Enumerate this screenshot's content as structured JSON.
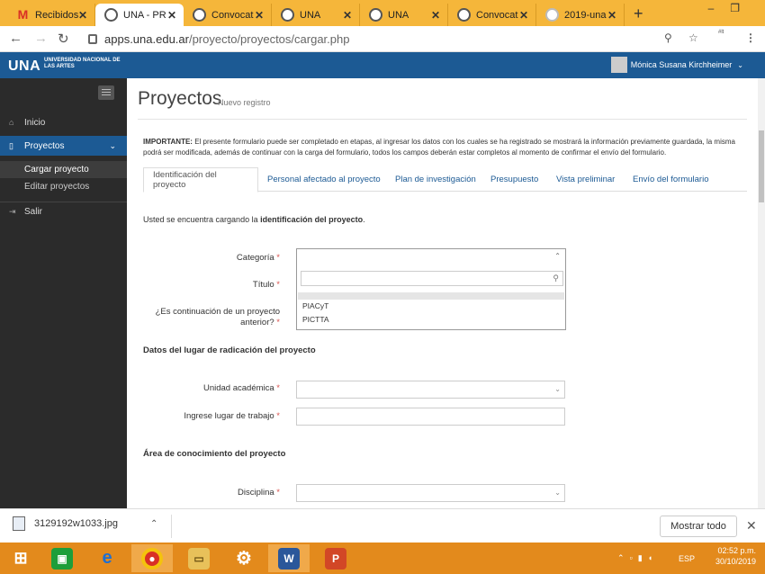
{
  "browser": {
    "tabs": [
      {
        "label": "Recibidos",
        "icon": "gmail-icon",
        "active": false
      },
      {
        "label": "UNA - PR",
        "icon": "una-favicon-icon",
        "active": true
      },
      {
        "label": "Convocat",
        "icon": "una-favicon-icon",
        "active": false
      },
      {
        "label": "UNA",
        "icon": "una-favicon-icon",
        "active": false
      },
      {
        "label": "UNA",
        "icon": "una-favicon-icon",
        "active": false
      },
      {
        "label": "Convocat",
        "icon": "una-favicon-icon",
        "active": false
      },
      {
        "label": "2019-una",
        "icon": "chrome-favicon-icon",
        "active": false
      }
    ],
    "url_domain": "apps.una.edu.ar",
    "url_path": "/proyecto/proyectos/cargar.php"
  },
  "header": {
    "logo": "UNA",
    "logo_subtitle": "UNIVERSIDAD NACIONAL DE LAS ARTES",
    "user_name": "Mónica Susana Kirchheimer"
  },
  "sidebar": {
    "items": [
      {
        "label": "Inicio",
        "icon": "home-icon"
      },
      {
        "label": "Proyectos",
        "icon": "file-icon"
      },
      {
        "label": "Salir",
        "icon": "sign-out-icon"
      }
    ],
    "subitems": [
      "Cargar proyecto",
      "Editar proyectos"
    ]
  },
  "page": {
    "title": "Proyectos",
    "subtitle": "Nuevo registro",
    "notice_bold": "IMPORTANTE:",
    "notice_text": " El presente formulario puede ser completado en etapas, al ingresar los datos con los cuales se ha registrado se mostrará la información previamente guardada, la misma podrá ser modificada, además de continuar con la carga del formulario, todos los campos deberán estar completos al momento de confirmar el envío del formulario.",
    "tabs": [
      "Identificación del proyecto",
      "Personal afectado al proyecto",
      "Plan de investigación",
      "Presupuesto",
      "Vista preliminar",
      "Envío del formulario"
    ],
    "intro_text": "Usted se encuentra cargando la ",
    "intro_bold": "identificación del proyecto",
    "intro_end": "."
  },
  "form": {
    "categoria_label": "Categoría",
    "titulo_label": "Título",
    "continuacion_label_1": "¿Es continuación de un proyecto",
    "continuacion_label_2": "anterior?",
    "required_mark": "*",
    "categoria_options": [
      "PIACyT",
      "PICTTA"
    ],
    "section_radicacion": "Datos del lugar de radicación del proyecto",
    "unidad_label": "Unidad académica",
    "lugar_label": "Ingrese lugar de trabajo",
    "section_area": "Área de conocimiento del proyecto",
    "disciplina_label": "Disciplina"
  },
  "downloads": {
    "file_name": "3129192w1033.jpg",
    "show_all": "Mostrar todo"
  },
  "taskbar": {
    "language": "ESP",
    "time": "02:52 p.m.",
    "date": "30/10/2019"
  }
}
